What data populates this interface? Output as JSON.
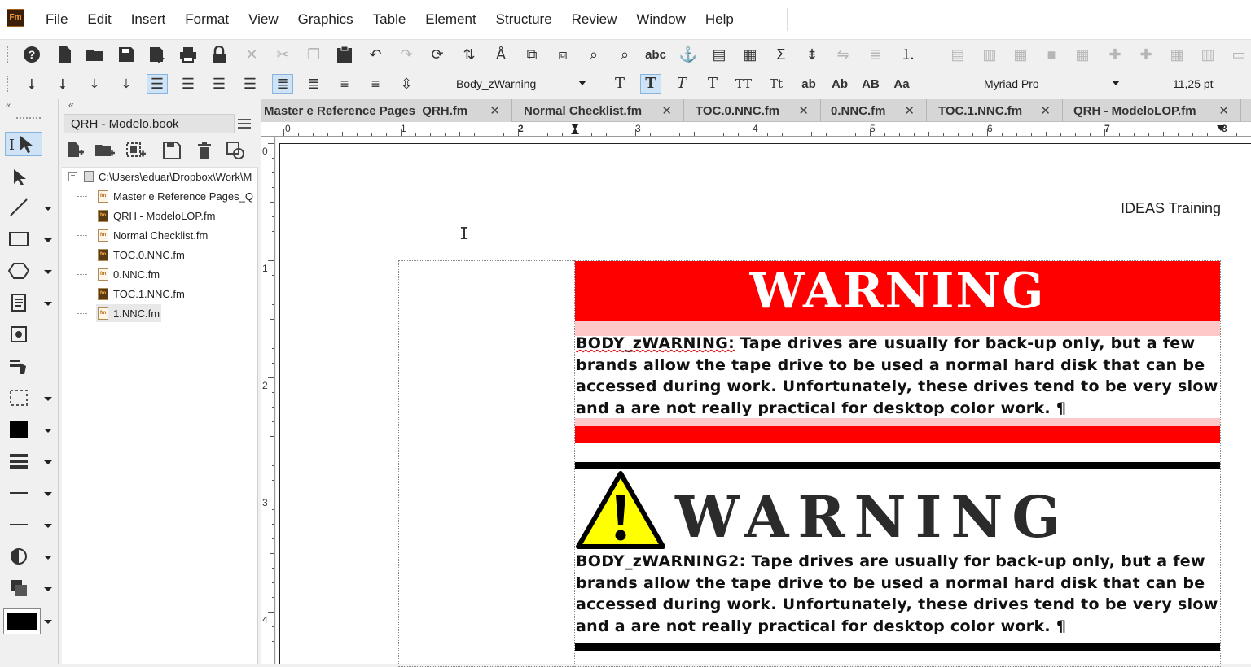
{
  "app": {
    "logo_text": "Fm"
  },
  "menu": [
    "File",
    "Edit",
    "Insert",
    "Format",
    "View",
    "Graphics",
    "Table",
    "Element",
    "Structure",
    "Review",
    "Window",
    "Help"
  ],
  "format_bar": {
    "paragraph_tag": "Body_zWarning",
    "font": "Myriad Pro",
    "size": "11,25 pt",
    "text_styles": [
      "T",
      "T",
      "T",
      "T",
      "TT",
      "Tt",
      "ab",
      "Ab",
      "AB",
      "Aa"
    ]
  },
  "book_panel": {
    "tab_label": "QRH - Modelo.book",
    "root_path": "C:\\Users\\eduar\\Dropbox\\Work\\M",
    "files": [
      {
        "name": "Master e Reference Pages_Q",
        "icon": "fm-file-icon"
      },
      {
        "name": "QRH - ModeloLOP.fm",
        "icon": "fm-open-file-icon"
      },
      {
        "name": "Normal Checklist.fm",
        "icon": "fm-file-icon"
      },
      {
        "name": "TOC.0.NNC.fm",
        "icon": "fm-open-file-icon"
      },
      {
        "name": "0.NNC.fm",
        "icon": "fm-file-icon"
      },
      {
        "name": "TOC.1.NNC.fm",
        "icon": "fm-open-file-icon"
      },
      {
        "name": "1.NNC.fm",
        "icon": "fm-file-icon"
      }
    ]
  },
  "doc_tabs": [
    {
      "label": "Master e Reference Pages_QRH.fm",
      "close": "✕"
    },
    {
      "label": "Normal Checklist.fm",
      "close": "✕"
    },
    {
      "label": "TOC.0.NNC.fm",
      "close": "✕"
    },
    {
      "label": "0.NNC.fm",
      "close": "✕"
    },
    {
      "label": "TOC.1.NNC.fm",
      "close": "✕"
    },
    {
      "label": "QRH - ModeloLOP.fm",
      "close": "✕"
    }
  ],
  "ruler": {
    "horizontal": [
      "0",
      "1",
      "2",
      "3",
      "4",
      "5",
      "6",
      "7",
      "8"
    ],
    "vertical": [
      "0",
      "1",
      "2",
      "3",
      "4"
    ]
  },
  "document": {
    "header_text": "IDEAS Training",
    "warning1": {
      "title": "WARNING",
      "tag": "BODY_zWARNING:",
      "body_a": " Tape drives are ",
      "body_b": "usually for back-up only, but a few brands allow the tape drive to be used a normal hard disk that can be accessed during work. Unfortunately, these drives tend to be very slow and a are not really practical for desktop color work. ¶",
      "colors": {
        "banner": "#ff0000",
        "band": "#ffc8c8"
      }
    },
    "warning2": {
      "title": "WARNING",
      "body": "BODY_zWARNING2: Tape drives are usually for back-up only, but a few brands allow the tape drive to be used a normal hard disk that can be accessed during work. Unfortunately, these drives tend to be very slow and a are not really practical for desktop color work. ¶",
      "colors": {
        "triangle": "#ffff00",
        "rule": "#000000"
      }
    }
  }
}
